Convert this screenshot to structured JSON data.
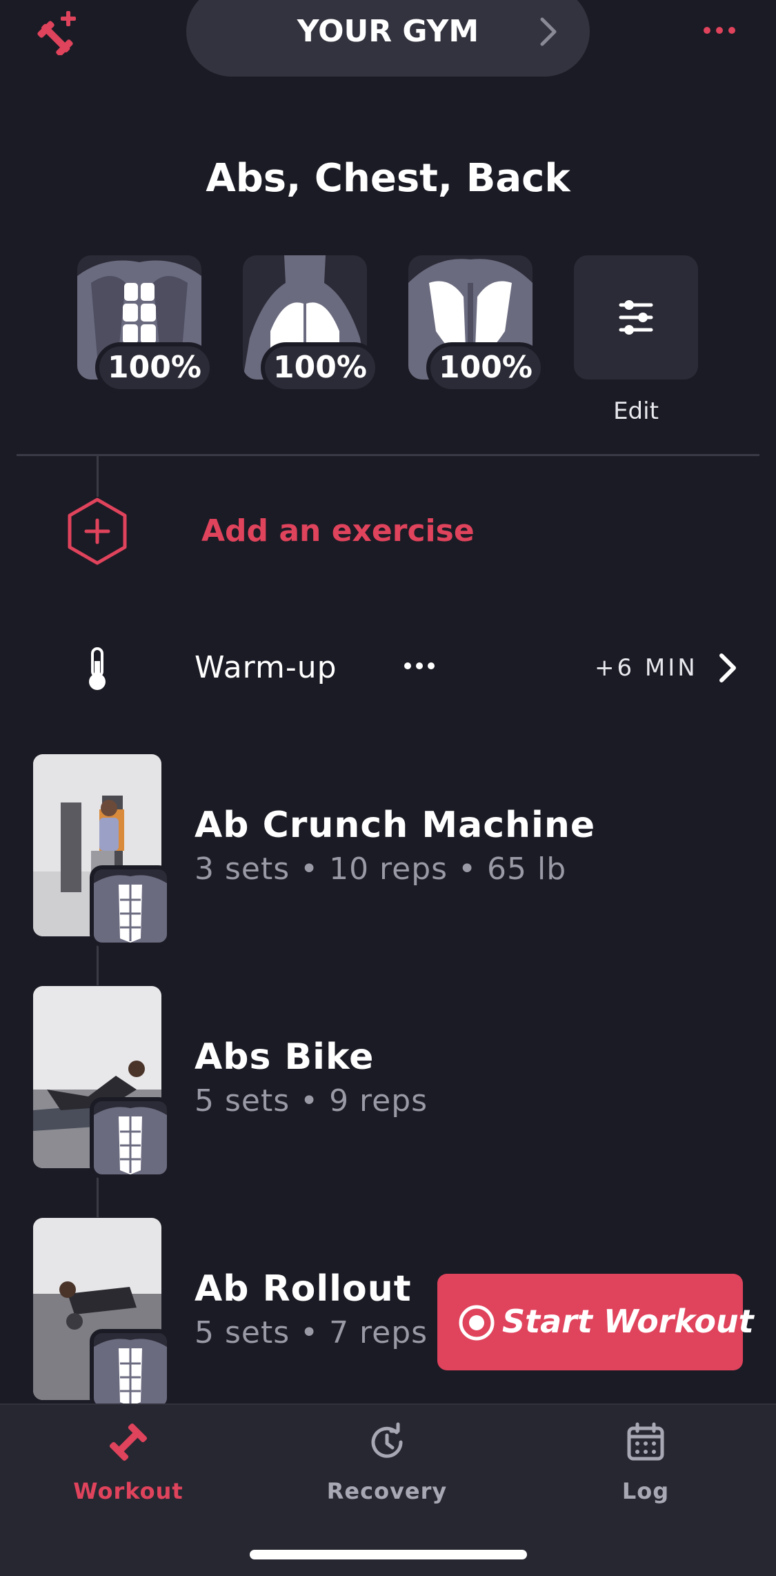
{
  "header": {
    "gym_button_label": "YOUR GYM",
    "add_workout_icon": "dumbbell-plus-icon",
    "more_icon": "more-horizontal-icon",
    "accent_color": "#e0435c"
  },
  "workout_title": "Abs, Chest, Back",
  "muscle_groups": [
    {
      "muscle": "abs",
      "recovery": "100%"
    },
    {
      "muscle": "chest",
      "recovery": "100%"
    },
    {
      "muscle": "back",
      "recovery": "100%"
    }
  ],
  "edit_label": "Edit",
  "add_exercise_label": "Add an exercise",
  "warmup": {
    "label": "Warm-up",
    "time": "+6 MIN"
  },
  "exercises": [
    {
      "name": "Ab Crunch Machine",
      "detail": "3 sets • 10 reps • 65 lb"
    },
    {
      "name": "Abs Bike",
      "detail": "5 sets • 9 reps"
    },
    {
      "name": "Ab Rollout",
      "detail": "5 sets • 7 reps"
    }
  ],
  "start_button_label": "Start Workout",
  "tabs": [
    {
      "label": "Workout",
      "icon": "dumbbell-icon",
      "active": true
    },
    {
      "label": "Recovery",
      "icon": "clock-refresh-icon",
      "active": false
    },
    {
      "label": "Log",
      "icon": "calendar-icon",
      "active": false
    }
  ]
}
